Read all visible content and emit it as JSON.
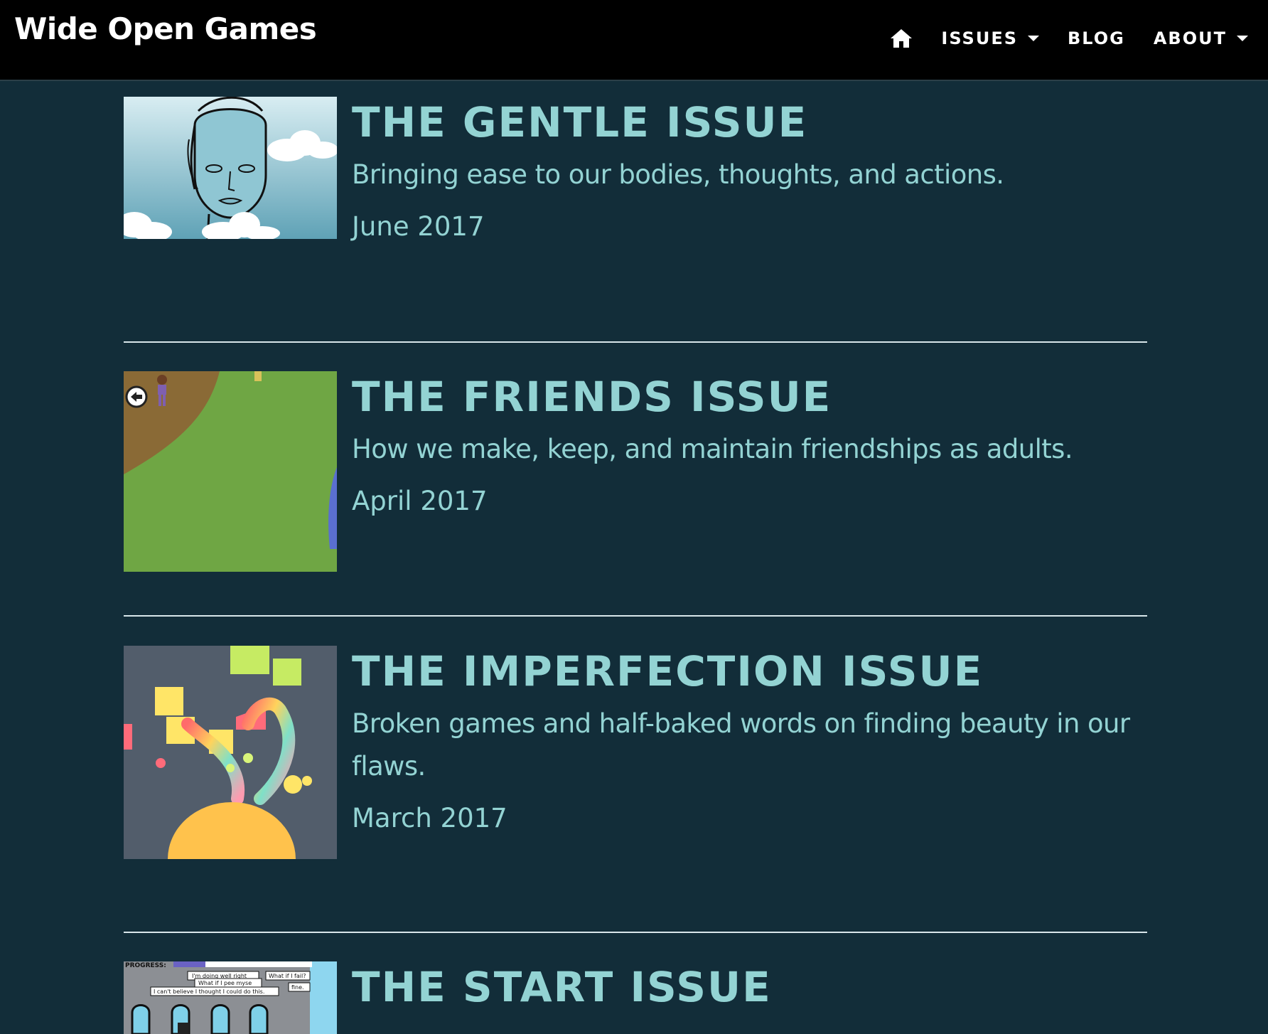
{
  "nav": {
    "brand": "Wide Open Games",
    "home_icon": "home-icon",
    "items": [
      {
        "label": "ISSUES",
        "has_dropdown": true
      },
      {
        "label": "BLOG",
        "has_dropdown": false
      },
      {
        "label": "ABOUT",
        "has_dropdown": true
      }
    ]
  },
  "issues": [
    {
      "title": "THE GENTLE ISSUE",
      "description": "Bringing ease to our bodies, thoughts, and actions.",
      "date": "June 2017"
    },
    {
      "title": "THE FRIENDS ISSUE",
      "description": "How we make, keep, and maintain friendships as adults.",
      "date": "April 2017"
    },
    {
      "title": "THE IMPERFECTION ISSUE",
      "description": "Broken games and half-baked words on finding beauty in our flaws.",
      "date": "March 2017"
    },
    {
      "title": "THE START ISSUE",
      "description": "",
      "date": ""
    }
  ],
  "thumb_text": {
    "progress_label": "PROGRESS:",
    "bubbles": [
      "I'm doing well right",
      "What if I fail?",
      "What if I pee myse",
      "fine.",
      "I can't believe I thought I could do this."
    ]
  },
  "colors": {
    "background": "#122d39",
    "accent_text": "#93d3d3",
    "navbar": "#000000"
  }
}
